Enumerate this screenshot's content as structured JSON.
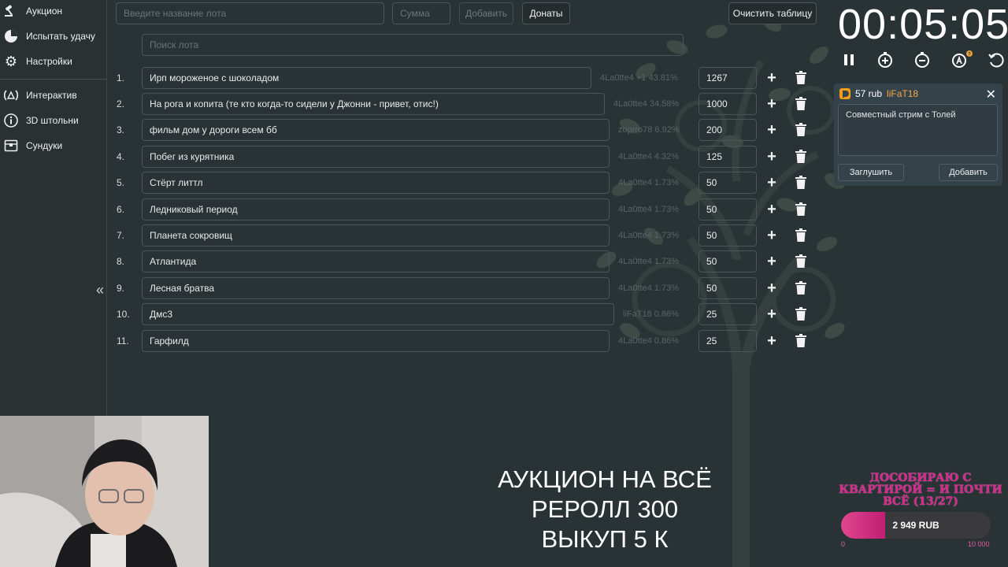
{
  "sidebar": {
    "items": [
      {
        "label": "Аукцион",
        "icon": "gavel-icon"
      },
      {
        "label": "Испытать удачу",
        "icon": "pie-chart-icon"
      },
      {
        "label": "Настройки",
        "icon": "gear-icon"
      },
      {
        "label": "Интерактив",
        "icon": "broadcast-icon"
      },
      {
        "label": "3D штольни",
        "icon": "info-icon"
      },
      {
        "label": "Сундуки",
        "icon": "chest-icon"
      }
    ],
    "collapse_label": "«"
  },
  "toolbar": {
    "lot_placeholder": "Введите название лота",
    "sum_placeholder": "Сумма",
    "add_label": "Добавить",
    "donations_label": "Донаты",
    "clear_label": "Очистить таблицу",
    "search_placeholder": "Поиск лота"
  },
  "lots": [
    {
      "num": "1.",
      "name": "Ирп мороженое с шоколадом",
      "meta": "4La0tte4 +1  43.81%",
      "amount": "1267"
    },
    {
      "num": "2.",
      "name": "На рога и копита (те кто когда-то сидели у Джонни - привет, отис!)",
      "meta": "4La0tte4  34.58%",
      "amount": "1000"
    },
    {
      "num": "3.",
      "name": "фильм дом у дороги всем бб",
      "meta": "zoprro78  6.92%",
      "amount": "200"
    },
    {
      "num": "4.",
      "name": "Побег из курятника",
      "meta": "4La0tte4  4.32%",
      "amount": "125"
    },
    {
      "num": "5.",
      "name": "Стёрт литтл",
      "meta": "4La0tte4  1.73%",
      "amount": "50"
    },
    {
      "num": "6.",
      "name": "Ледниковый период",
      "meta": "4La0tte4  1.73%",
      "amount": "50"
    },
    {
      "num": "7.",
      "name": "Планета сокровищ",
      "meta": "4La0tte4  1.73%",
      "amount": "50"
    },
    {
      "num": "8.",
      "name": "Атлантида",
      "meta": "4La0tte4  1.73%",
      "amount": "50"
    },
    {
      "num": "9.",
      "name": "Лесная братва",
      "meta": "4La0tte4  1.73%",
      "amount": "50"
    },
    {
      "num": "10.",
      "name": "Дмс3",
      "meta": "liFaT18  0.86%",
      "amount": "25"
    },
    {
      "num": "11.",
      "name": "Гарфилд",
      "meta": "4La0tte4  0.86%",
      "amount": "25"
    }
  ],
  "timer": {
    "time": "00:05:05",
    "controls": [
      "pause-icon",
      "add-time-icon",
      "subtract-time-icon",
      "stopwatch-icon",
      "reset-icon"
    ]
  },
  "donation": {
    "amount": "57 rub",
    "user": "liFaT18",
    "message": "Совместный стрим с Толей",
    "mute_label": "Заглушить",
    "add_label": "Добавить"
  },
  "overlay": {
    "line1": "АУКЦИОН НА ВСЁ",
    "line2": "РЕРОЛЛ 300",
    "line3": "ВЫКУП 5 К"
  },
  "goal": {
    "title": "ДОСОБИРАЮ С КВАРТИРОЙ = И ПОЧТИ ВСЁ (13/27)",
    "value_label": "2 949 RUB",
    "min": "0",
    "max": "10 000",
    "progress": 0.2949
  },
  "colors": {
    "background": "#293235",
    "donor_name": "#f6a54b",
    "goal_pink": "#d6278d"
  }
}
